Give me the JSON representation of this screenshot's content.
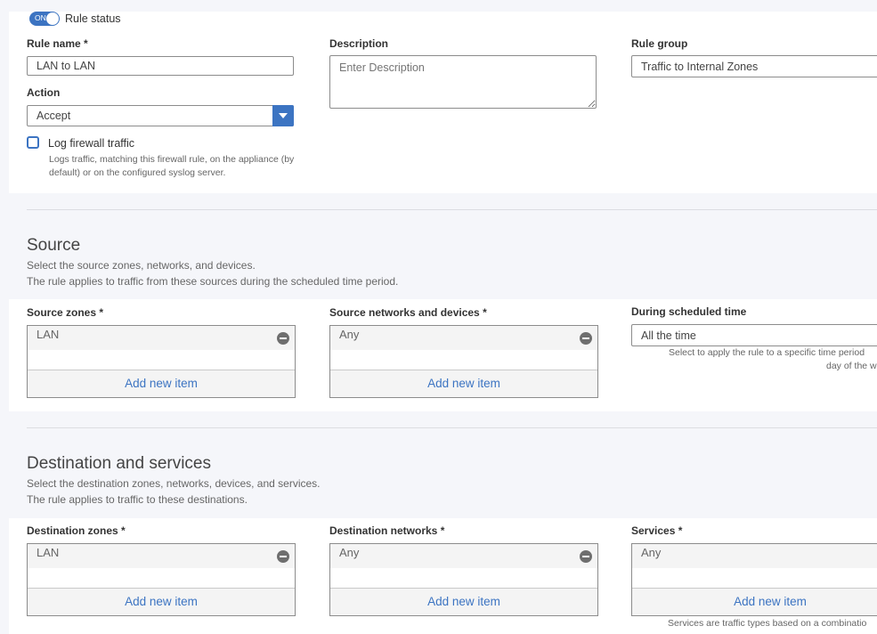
{
  "rule_status": {
    "toggle_text": "ON",
    "label": "Rule status"
  },
  "rule_name": {
    "label": "Rule name *",
    "value": "LAN to LAN"
  },
  "description": {
    "label": "Description",
    "placeholder": "Enter Description"
  },
  "rule_group": {
    "label": "Rule group",
    "value": "Traffic to Internal Zones"
  },
  "action": {
    "label": "Action",
    "value": "Accept"
  },
  "log": {
    "label": "Log firewall traffic",
    "hint_line1": "Logs traffic, matching this firewall rule, on the appliance (by",
    "hint_line2": "default) or on the configured syslog server."
  },
  "source": {
    "title": "Source",
    "sub1": "Select the source zones, networks, and devices.",
    "sub2": "The rule applies to traffic from these sources during the scheduled time period.",
    "zones": {
      "label": "Source zones *",
      "item": "LAN",
      "add": "Add new item"
    },
    "networks": {
      "label": "Source networks and devices *",
      "item": "Any",
      "add": "Add new item"
    },
    "schedule": {
      "label": "During scheduled time",
      "value": "All the time",
      "hint_line1": "Select to apply the rule to a specific time period",
      "hint_line2": "day of the w"
    }
  },
  "destination": {
    "title": "Destination and services",
    "sub1": "Select the destination zones, networks, devices, and services.",
    "sub2": "The rule applies to traffic to these destinations.",
    "zones": {
      "label": "Destination zones *",
      "item": "LAN",
      "add": "Add new item"
    },
    "networks": {
      "label": "Destination networks *",
      "item": "Any",
      "add": "Add new item"
    },
    "services": {
      "label": "Services *",
      "item": "Any",
      "add": "Add new item",
      "hint": "Services are traffic types based on a combinatio"
    }
  },
  "colors": {
    "accent": "#3c74c2",
    "panel_bg": "#ffffff",
    "page_bg": "#f5f6fa"
  },
  "icons": {
    "remove": "minus-circle-icon",
    "dropdown": "chevron-down-icon",
    "toggle": "toggle-switch"
  }
}
